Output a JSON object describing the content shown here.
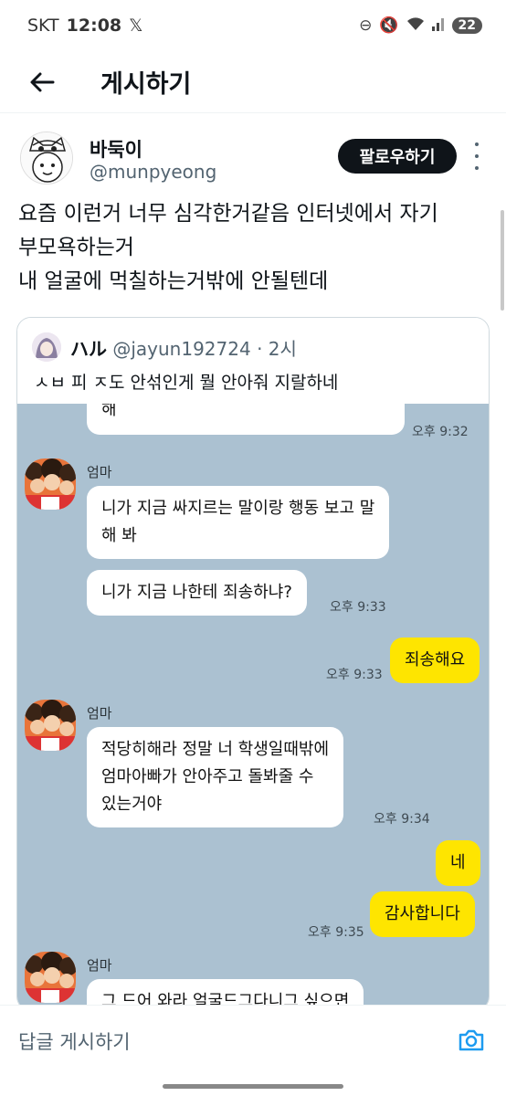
{
  "status_bar": {
    "carrier": "SKT",
    "time": "12:08",
    "x_logo": "𝕏",
    "battery": "22"
  },
  "header": {
    "title": "게시하기"
  },
  "post": {
    "author_name": "바둑이",
    "author_handle": "@munpyeong",
    "follow_label": "팔로우하기",
    "text_lines": [
      "요즘 이런거 너무 심각한거같음 인터넷에서 자기",
      "부모욕하는거",
      "내 얼굴에 먹칠하는거밖에 안될텐데"
    ]
  },
  "quote": {
    "name": "ハル",
    "handle": "@jayun192724",
    "time": "· 2시",
    "text": "ㅅㅂ 피 ㅈ도 안섞인게 뭘 안아줘 지랄하네"
  },
  "chat": {
    "partial_top": "해",
    "partial_top_time": "오후 9:32",
    "sender": "엄마",
    "msg1_line1": "니가 지금 싸지르는 말이랑 행동 보고 말",
    "msg1_line2": "해 봐",
    "msg2": "니가 지금 나한테 죄송하냐?",
    "msg2_time": "오후 9:33",
    "my1": "죄송해요",
    "my1_time": "오후 9:33",
    "msg3_line1": "적당히해라 정말 너 학생일때밖에",
    "msg3_line2": "엄마아빠가 안아주고 돌봐줄 수",
    "msg3_line3": "있는거야",
    "msg3_time": "오후 9:34",
    "my2": "네",
    "my3": "감사합니다",
    "my3_time": "오후 9:35",
    "partial_bottom": "그 드어 와라 얼굴드그다니그 싶으면"
  },
  "reply_bar": {
    "placeholder": "답글 게시하기"
  }
}
